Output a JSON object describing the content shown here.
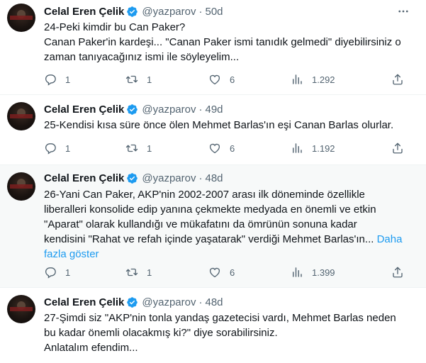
{
  "author": {
    "name": "Celal Eren Çelik",
    "handle": "@yazparov"
  },
  "tweets": [
    {
      "time": "50d",
      "lines": [
        "24-Peki kimdir bu Can Paker?",
        "Canan Paker'in kardeşi... \"Canan Paker ismi tanıdık gelmedi\" diyebilirsiniz o",
        "zaman tanıyacağınız ismi ile söyleyelim..."
      ],
      "replies": "1",
      "retweets": "1",
      "likes": "6",
      "views": "1.292"
    },
    {
      "time": "49d",
      "lines": [
        "25-Kendisi kısa süre önce ölen Mehmet Barlas'ın eşi Canan Barlas olurlar."
      ],
      "replies": "1",
      "retweets": "1",
      "likes": "6",
      "views": "1.192"
    },
    {
      "time": "48d",
      "lines": [
        "26-Yani Can Paker, AKP'nin 2002-2007 arası ilk döneminde özellikle",
        "liberalleri konsolide edip yanına çekmekte medyada en önemli ve etkin",
        "\"Aparat\" olarak kullandığı ve mükafatını da ömrünün sonuna kadar",
        "kendisini \"Rahat ve refah içinde yaşatarak\" verdiği Mehmet Barlas'ın..."
      ],
      "show_more_inline": "Daha",
      "show_more_line2": "fazla göster",
      "replies": "1",
      "retweets": "1",
      "likes": "6",
      "views": "1.399"
    },
    {
      "time": "48d",
      "lines": [
        "27-Şimdi siz \"AKP'nin tonla yandaş gazetecisi vardı, Mehmet Barlas neden",
        "bu kadar önemli olacakmış ki?\" diye sorabilirsiniz.",
        "Anlatalım efendim..."
      ]
    }
  ],
  "colors": {
    "verified": "#1d9bf0",
    "secondary_text": "#536471",
    "link": "#1d9bf0",
    "highlight_bg": "#f7f9f9"
  }
}
